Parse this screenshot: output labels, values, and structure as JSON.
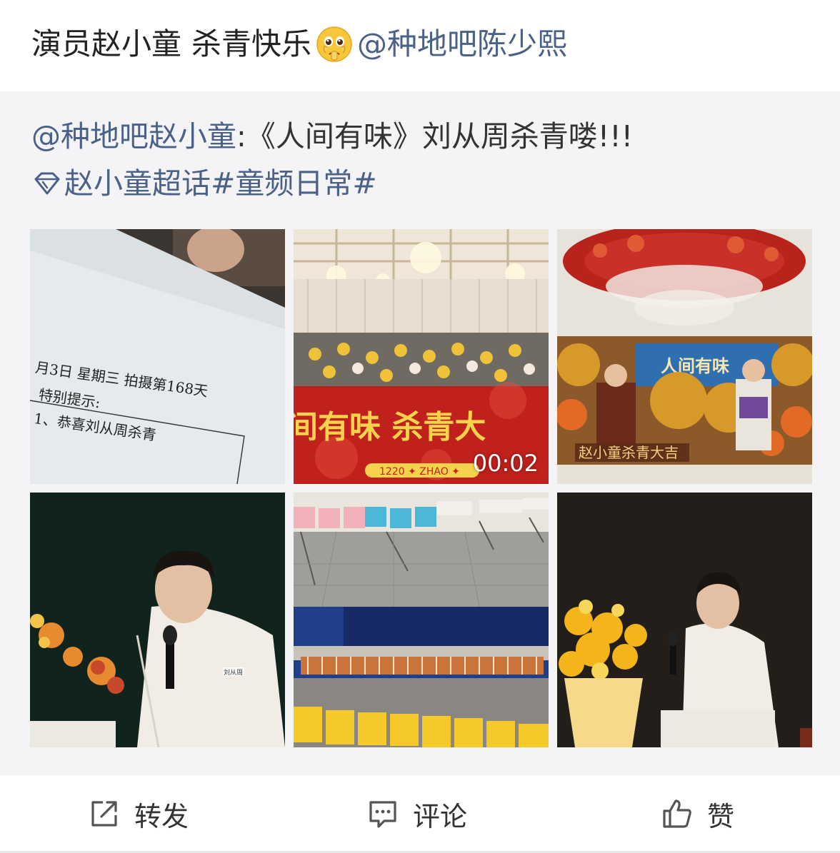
{
  "post": {
    "text_part1": "演员赵小童",
    "text_part2": "杀青快乐",
    "emoji": "pleading-face-emoji",
    "mention": "@种地吧陈少熙"
  },
  "repost": {
    "author_mention": "@种地吧赵小童",
    "content": ":《人间有味》刘从周杀青喽!!!",
    "super_topic_icon": "diamond-icon",
    "topic": "赵小童超话#童频日常#"
  },
  "media": {
    "images": [
      {
        "name": "schedule-paper-photo",
        "text": "月3日 星期三 拍摄第168天 特别提示: 1、恭喜刘从周杀青"
      },
      {
        "name": "fan-group-video",
        "banner": "人间有味 杀青大吉",
        "duration": "00:02"
      },
      {
        "name": "flower-stage-photo",
        "banner": "赵小童杀青大吉"
      },
      {
        "name": "chef-speech-photo"
      },
      {
        "name": "gift-tables-photo"
      },
      {
        "name": "flowers-bouquet-photo"
      }
    ]
  },
  "actions": {
    "forward_label": "转发",
    "comment_label": "评论",
    "like_label": "赞"
  },
  "colors": {
    "mention": "#4a6188",
    "repost_bg": "#f4f4f6"
  }
}
